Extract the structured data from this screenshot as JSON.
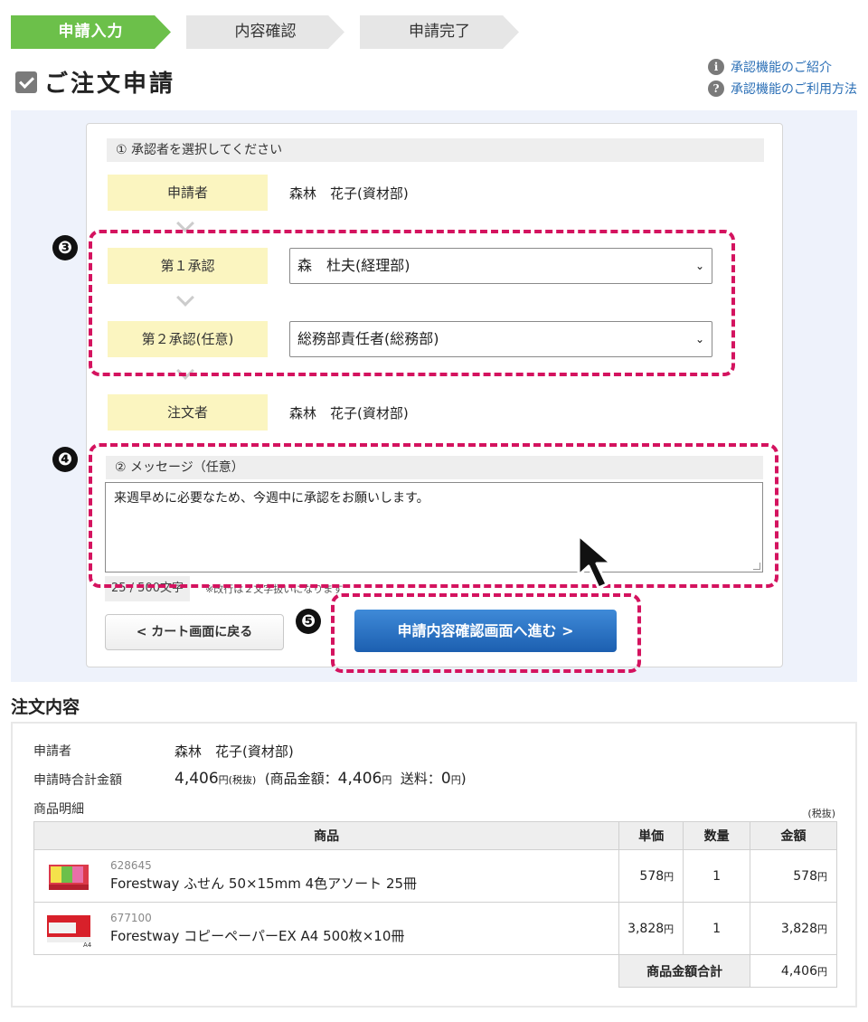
{
  "steps": [
    "申請入力",
    "内容確認",
    "申請完了"
  ],
  "page_title": "ご注文申請",
  "help_links": [
    {
      "icon": "i",
      "label": "承認機能のご紹介"
    },
    {
      "icon": "?",
      "label": "承認機能のご利用方法"
    }
  ],
  "approvers": {
    "section_title": "① 承認者を選択してください",
    "applicant_label": "申請者",
    "applicant_value": "森林　花子(資材部)",
    "first_label": "第１承認",
    "first_value": "森　杜夫(経理部)",
    "second_label": "第２承認(任意)",
    "second_value": "総務部責任者(総務部)",
    "orderer_label": "注文者",
    "orderer_value": "森林　花子(資材部)"
  },
  "message": {
    "section_title": "② メッセージ（任意）",
    "text": "来週早めに必要なため、今週中に承認をお願いします。",
    "count": "25 / 500文字",
    "note": "※改行は２文字扱いになります"
  },
  "markers": [
    "❸",
    "❹",
    "❺"
  ],
  "buttons": {
    "back": "< カート画面に戻る",
    "next": "申請内容確認画面へ進む >"
  },
  "order": {
    "title": "注文内容",
    "applicant_label": "申請者",
    "applicant_value": "森林　花子(資材部)",
    "total_label": "申請時合計金額",
    "total_amount": "4,406",
    "yen": "円",
    "tax_ex": "(税抜)",
    "breakdown_prefix": "(商品金額：",
    "breakdown_goods": "4,406",
    "shipping_label": "送料：",
    "shipping_value": "0",
    "breakdown_suffix": ")",
    "details_label": "商品明細",
    "tax_note": "(税抜)",
    "columns": [
      "商品",
      "単価",
      "数量",
      "金額"
    ],
    "items": [
      {
        "code": "628645",
        "name": "Forestway ふせん 50×15mm 4色アソート 25冊",
        "unit_price": "578",
        "qty": "1",
        "amount": "578"
      },
      {
        "code": "677100",
        "name": "Forestway コピーペーパーEX A4 500枚×10冊",
        "unit_price": "3,828",
        "qty": "1",
        "amount": "3,828"
      }
    ],
    "subtotal_label": "商品金額合計",
    "subtotal_value": "4,406"
  }
}
